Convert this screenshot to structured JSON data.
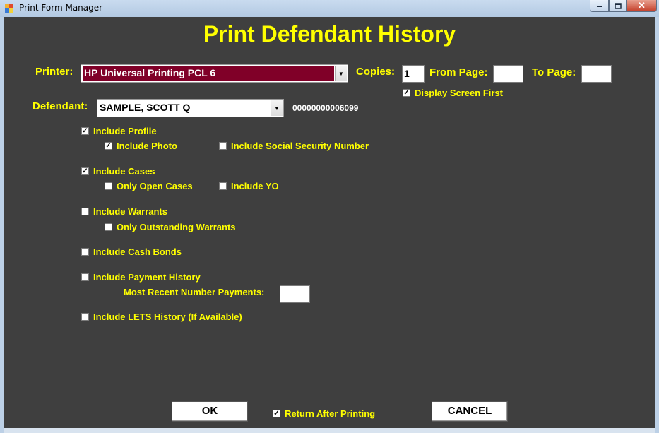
{
  "window": {
    "title": "Print Form Manager"
  },
  "heading": "Print Defendant History",
  "printer": {
    "label": "Printer:",
    "value": "HP Universal Printing PCL 6"
  },
  "copies": {
    "label": "Copies:",
    "value": "1"
  },
  "from_page": {
    "label": "From Page:",
    "value": ""
  },
  "to_page": {
    "label": "To Page:",
    "value": ""
  },
  "display_screen_first": {
    "label": "Display Screen First",
    "checked": true
  },
  "defendant": {
    "label": "Defendant:",
    "value": "SAMPLE, SCOTT Q",
    "id": "00000000006099"
  },
  "options": {
    "include_profile": {
      "label": "Include Profile",
      "checked": true
    },
    "include_photo": {
      "label": "Include Photo",
      "checked": true
    },
    "include_ssn": {
      "label": "Include Social Security Number",
      "checked": false
    },
    "include_cases": {
      "label": "Include Cases",
      "checked": true
    },
    "only_open_cases": {
      "label": "Only Open Cases",
      "checked": false
    },
    "include_yo": {
      "label": "Include YO",
      "checked": false
    },
    "include_warrants": {
      "label": "Include Warrants",
      "checked": false
    },
    "only_outstanding_warrants": {
      "label": "Only Outstanding Warrants",
      "checked": false
    },
    "include_cash_bonds": {
      "label": "Include Cash Bonds",
      "checked": false
    },
    "include_payment_history": {
      "label": "Include Payment History",
      "checked": false
    },
    "most_recent_payments": {
      "label": "Most Recent Number Payments:",
      "value": ""
    },
    "include_lets_history": {
      "label": "Include LETS History (If Available)",
      "checked": false
    }
  },
  "footer": {
    "ok": "OK",
    "cancel": "CANCEL",
    "return_after_printing": {
      "label": "Return After Printing",
      "checked": true
    }
  },
  "colors": {
    "accent_text": "#ffff00",
    "panel_bg": "#3f3f3f",
    "printer_selected_bg": "#800028"
  }
}
